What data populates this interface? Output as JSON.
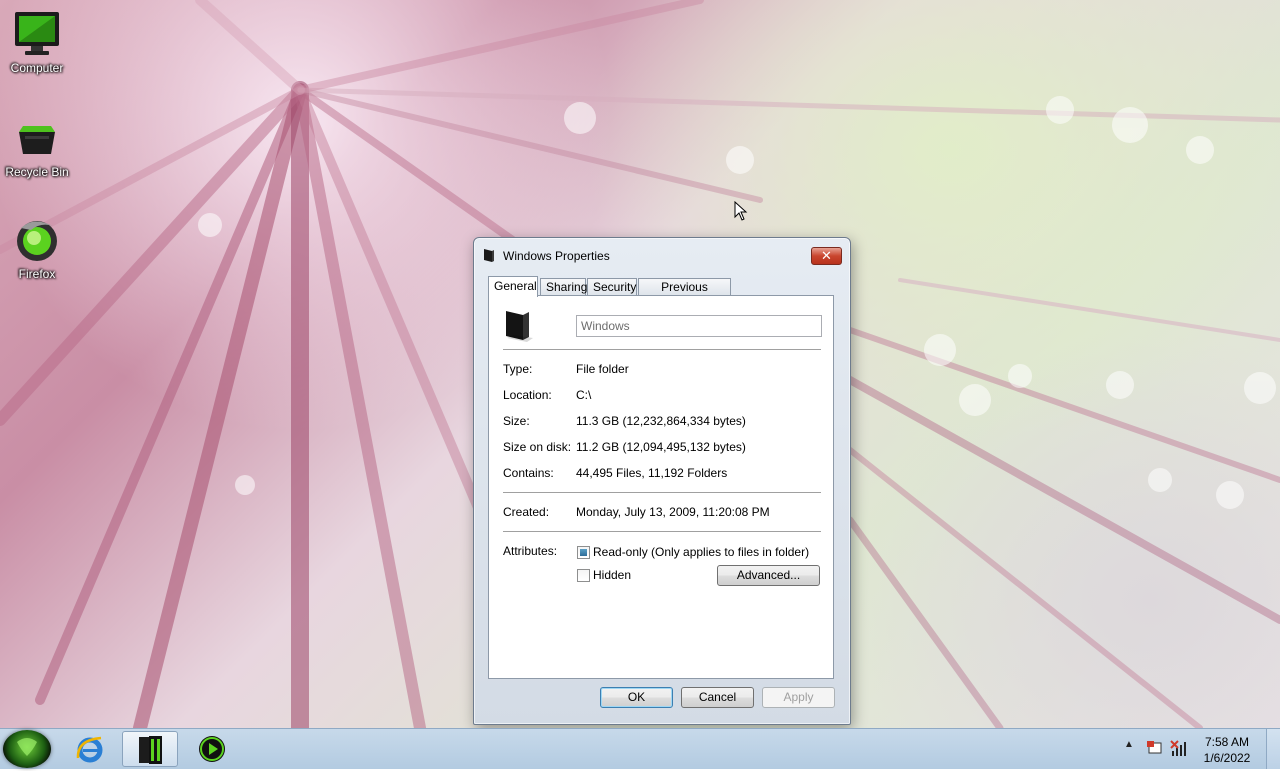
{
  "desktop": {
    "icons": [
      {
        "label": "Computer",
        "icon": "computer-icon"
      },
      {
        "label": "Recycle Bin",
        "icon": "recycle-bin-icon"
      },
      {
        "label": "Firefox",
        "icon": "firefox-icon"
      }
    ]
  },
  "dialog": {
    "title": "Windows Properties",
    "close_label": "✕",
    "tabs": [
      {
        "label": "General",
        "active": true
      },
      {
        "label": "Sharing",
        "active": false
      },
      {
        "label": "Security",
        "active": false
      },
      {
        "label": "Previous Versions",
        "active": false
      }
    ],
    "name_value": "Windows",
    "properties": {
      "type_label": "Type:",
      "type_value": "File folder",
      "location_label": "Location:",
      "location_value": "C:\\",
      "size_label": "Size:",
      "size_value": "11.3 GB (12,232,864,334 bytes)",
      "size_on_disk_label": "Size on disk:",
      "size_on_disk_value": "11.2 GB (12,094,495,132 bytes)",
      "contains_label": "Contains:",
      "contains_value": "44,495 Files, 11,192 Folders",
      "created_label": "Created:",
      "created_value": "Monday, July 13, 2009, 11:20:08 PM",
      "attributes_label": "Attributes:"
    },
    "attributes": {
      "readonly_label": "Read-only (Only applies to files in folder)",
      "readonly_checked": true,
      "hidden_label": "Hidden",
      "hidden_checked": false,
      "advanced_label": "Advanced..."
    },
    "buttons": {
      "ok": "OK",
      "cancel": "Cancel",
      "apply": "Apply"
    }
  },
  "taskbar": {
    "pinned": [
      {
        "icon": "internet-explorer-icon"
      },
      {
        "icon": "windows-explorer-icon",
        "active": true
      },
      {
        "icon": "media-player-icon"
      }
    ],
    "tray": {
      "chevron": "▲",
      "icons": [
        "action-center-icon",
        "network-icon"
      ]
    },
    "clock": {
      "time": "7:58 AM",
      "date": "1/6/2022"
    }
  },
  "colors": {
    "accent": "#3c7fb1",
    "taskbar": "#b3cbe1",
    "close_button": "#c9452e"
  }
}
